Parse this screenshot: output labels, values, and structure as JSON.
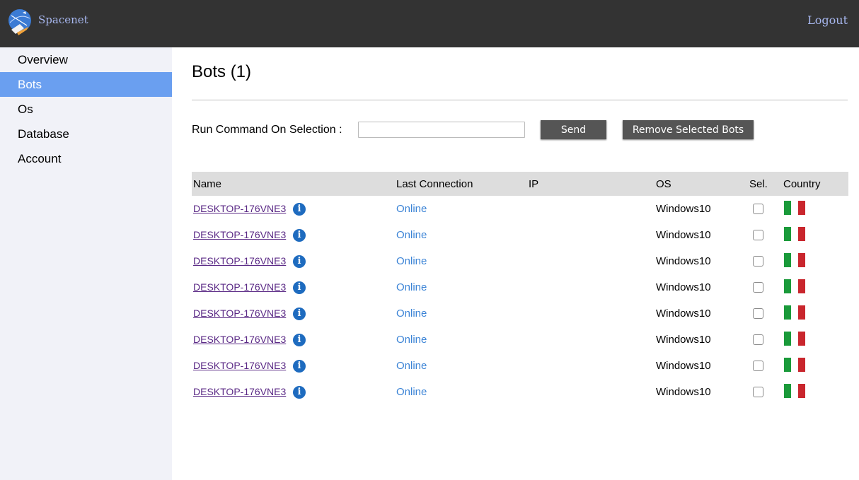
{
  "header": {
    "brand": "Spacenet",
    "logout_label": "Logout",
    "logo_icon": "satellite-logo"
  },
  "sidebar": {
    "items": [
      {
        "label": "Overview",
        "active": false
      },
      {
        "label": "Bots",
        "active": true
      },
      {
        "label": "Os",
        "active": false
      },
      {
        "label": "Database",
        "active": false
      },
      {
        "label": "Account",
        "active": false
      }
    ]
  },
  "main": {
    "title": "Bots (1)",
    "command": {
      "label": "Run Command On Selection :",
      "value": "",
      "placeholder": "",
      "send_label": "Send",
      "remove_label": "Remove Selected Bots"
    },
    "table": {
      "columns": [
        "Name",
        "Last Connection",
        "IP",
        "OS",
        "Sel.",
        "Country"
      ],
      "rows": [
        {
          "name": "DESKTOP-176VNE3",
          "last_connection": "Online",
          "ip": "",
          "os": "Windows10",
          "selected": false,
          "country_flag": "italy-flag"
        },
        {
          "name": "DESKTOP-176VNE3",
          "last_connection": "Online",
          "ip": "",
          "os": "Windows10",
          "selected": false,
          "country_flag": "italy-flag"
        },
        {
          "name": "DESKTOP-176VNE3",
          "last_connection": "Online",
          "ip": "",
          "os": "Windows10",
          "selected": false,
          "country_flag": "italy-flag"
        },
        {
          "name": "DESKTOP-176VNE3",
          "last_connection": "Online",
          "ip": "",
          "os": "Windows10",
          "selected": false,
          "country_flag": "italy-flag"
        },
        {
          "name": "DESKTOP-176VNE3",
          "last_connection": "Online",
          "ip": "",
          "os": "Windows10",
          "selected": false,
          "country_flag": "italy-flag"
        },
        {
          "name": "DESKTOP-176VNE3",
          "last_connection": "Online",
          "ip": "",
          "os": "Windows10",
          "selected": false,
          "country_flag": "italy-flag"
        },
        {
          "name": "DESKTOP-176VNE3",
          "last_connection": "Online",
          "ip": "",
          "os": "Windows10",
          "selected": false,
          "country_flag": "italy-flag"
        },
        {
          "name": "DESKTOP-176VNE3",
          "last_connection": "Online",
          "ip": "",
          "os": "Windows10",
          "selected": false,
          "country_flag": "italy-flag"
        }
      ]
    }
  },
  "colors": {
    "topbar": "#333333",
    "sidebar": "#f1f2f8",
    "sidebar_active": "#6a9ff0",
    "status_online": "#3c84d6",
    "link": "#5b2a86",
    "flag_green": "#1a9a3a",
    "flag_white": "#ffffff",
    "flag_red": "#c9262d"
  }
}
